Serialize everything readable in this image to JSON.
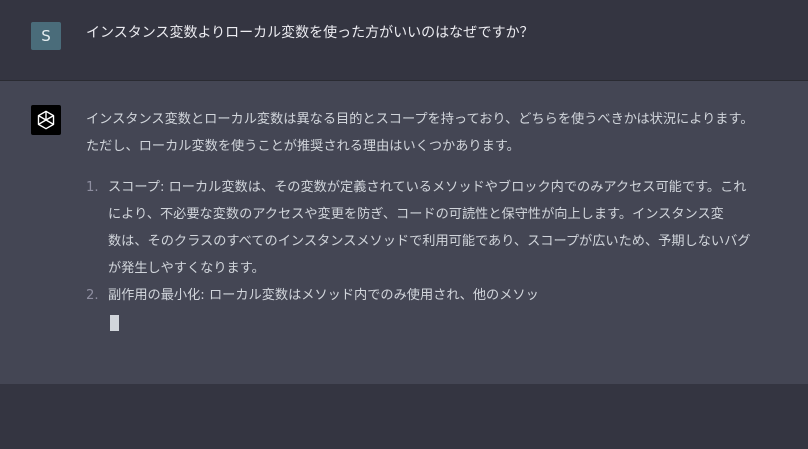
{
  "user_message": {
    "avatar_letter": "S",
    "text": "インスタンス変数よりローカル変数を使った方がいいのはなぜですか？"
  },
  "assistant_message": {
    "avatar_icon": "openai-logo-icon",
    "intro_lines": [
      "インスタンス変数とローカル変数は異なる目的とスコープを持っており、どちらを使うべきかは状況によります。",
      "ただし、ローカル変数を使うことが推奨される理由はいくつかあります。"
    ],
    "list_items": [
      {
        "number": "1.",
        "lines": [
          "スコープ: ローカル変数は、その変数が定義されているメソッドやブロック内でのみアクセス可能です。これ",
          "により、不必要な変数のアクセスや変更を防ぎ、コードの可読性と保守性が向上します。インスタンス変",
          "数は、そのクラスのすべてのインスタンスメソッドで利用可能であり、スコープが広いため、予期しないバグ",
          "が発生しやすくなります。"
        ]
      },
      {
        "number": "2.",
        "lines": [
          "副作用の最小化: ローカル変数はメソッド内でのみ使用され、他のメソッ"
        ]
      }
    ]
  },
  "colors": {
    "user_bg": "#343541",
    "assistant_bg": "#444654",
    "text": "#d1d5db",
    "avatar_user": "#4a6c7a"
  }
}
